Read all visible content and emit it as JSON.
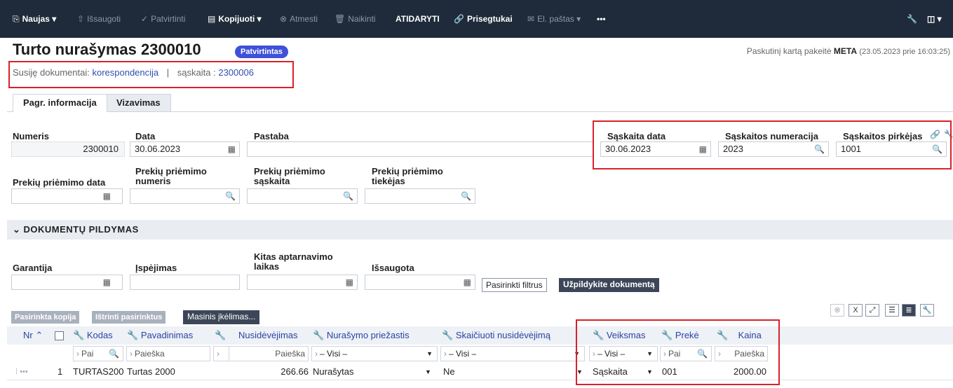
{
  "toolbar": {
    "new": "Naujas",
    "save": "Išsaugoti",
    "confirm": "Patvirtinti",
    "copy": "Kopijuoti",
    "discard": "Atmesti",
    "delete": "Naikinti",
    "open": "ATIDARYTI",
    "attachments": "Prisegtukai",
    "email": "El. paštas",
    "more": "•••"
  },
  "header": {
    "title": "Turto nurašymas 2300010",
    "status": "Patvirtintas",
    "last_modified_prefix": "Paskutinį kartą pakeitė",
    "last_modified_user": "META",
    "last_modified_date": "(23.05.2023 prie 16:03:25)",
    "related_label": "Susiję dokumentai:",
    "related_link": "korespondencija",
    "separator": "|",
    "invoice_label": "sąskaita :",
    "invoice_link": "2300006"
  },
  "tabs": [
    "Pagr. informacija",
    "Vizavimas"
  ],
  "fields": {
    "numeris": {
      "label": "Numeris",
      "value": "2300010"
    },
    "data": {
      "label": "Data",
      "value": "30.06.2023"
    },
    "pastaba": {
      "label": "Pastaba",
      "value": ""
    },
    "saskaita_data": {
      "label": "Sąskaita data",
      "value": "30.06.2023"
    },
    "saskaitos_numeracija": {
      "label": "Sąskaitos numeracija",
      "value": "2023"
    },
    "saskaitos_pirkejas": {
      "label": "Sąskaitos pirkėjas",
      "value": "1001"
    },
    "priemimo_data": {
      "label": "Prekių priėmimo data",
      "value": ""
    },
    "priemimo_numeris": {
      "label": "Prekių priėmimo numeris",
      "value": ""
    },
    "priemimo_saskaita": {
      "label": "Prekių priėmimo sąskaita",
      "value": ""
    },
    "priemimo_tiekejas": {
      "label": "Prekių priėmimo tiekėjas",
      "value": ""
    }
  },
  "section": {
    "title": "DOKUMENTŲ PILDYMAS",
    "garantija": "Garantija",
    "ispejimas": "Įspėjimas",
    "kitas": "Kitas aptarnavimo laikas",
    "issaugota": "Išsaugota",
    "filter_btn": "Pasirinkti filtrus",
    "fill_btn": "Užpildykite dokumentą"
  },
  "grid_actions": {
    "copy_selected": "Pasirinkta kopija",
    "delete_selected": "Ištrinti pasirinktus",
    "bulk_upload": "Masinis įkėlimas..."
  },
  "grid": {
    "headers": {
      "nr": "Nr",
      "kodas": "Kodas",
      "pavadinimas": "Pavadinimas",
      "nusidevejimas": "Nusidėvėjimas",
      "priezastis": "Nurašymo priežastis",
      "skaiciuoti": "Skaičiuoti nusidėvėjimą",
      "veiksmas": "Veiksmas",
      "preke": "Prekė",
      "kaina": "Kaina"
    },
    "filters": {
      "kodas": "Pai",
      "pavadinimas": "Paieška",
      "nusidevejimas": "Paieška",
      "priezastis": "– Visi –",
      "skaiciuoti": "– Visi –",
      "veiksmas": "– Visi –",
      "preke": "Pai",
      "kaina": "Paieška"
    },
    "rows": [
      {
        "nr": "1",
        "kodas": "TURTAS200",
        "pavadinimas": "Turtas 2000",
        "nusidevejimas": "266.66",
        "priezastis": "Nurašytas",
        "skaiciuoti": "Ne",
        "veiksmas": "Sąskaita",
        "preke": "001",
        "kaina": "2000.00"
      }
    ]
  }
}
